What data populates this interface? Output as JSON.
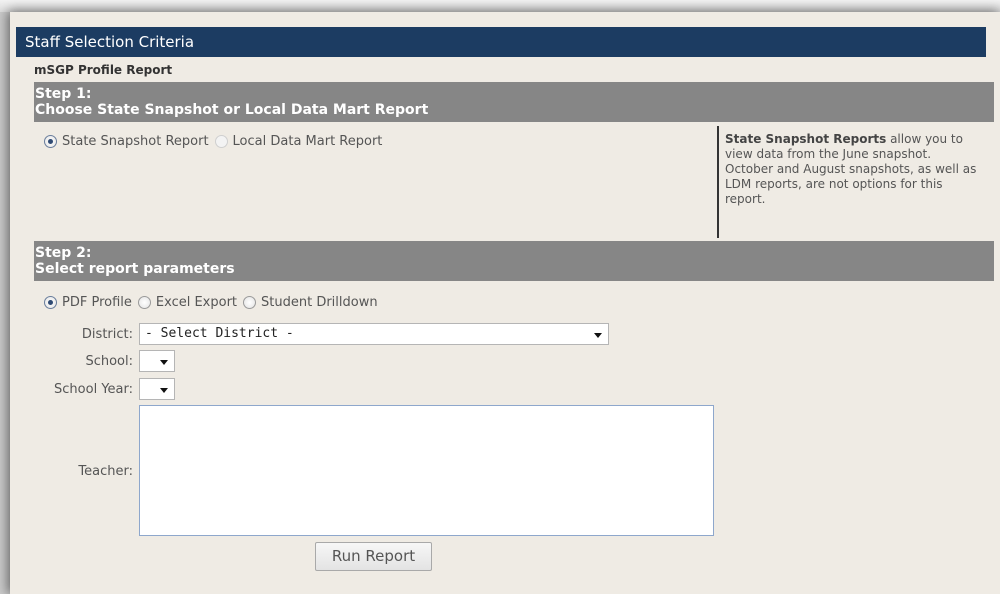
{
  "header": {
    "title": "Staff Selection Criteria",
    "report_name": "mSGP Profile Report"
  },
  "step1": {
    "heading": "Step 1:",
    "title": "Choose State Snapshot or Local Data Mart Report",
    "options": [
      "State Snapshot Report",
      "Local Data Mart Report"
    ],
    "selected": "State Snapshot Report",
    "info_bold": "State Snapshot Reports",
    "info_text": " allow you to view data from the June snapshot. October and August snapshots, as well as LDM reports, are not options for this report."
  },
  "step2": {
    "heading": "Step 2:",
    "title": "Select report parameters",
    "options": [
      "PDF Profile",
      "Excel Export",
      "Student Drilldown"
    ],
    "selected": "PDF Profile"
  },
  "form": {
    "district_label": "District:",
    "district_value": "- Select District -",
    "school_label": "School:",
    "school_value": "",
    "school_year_label": "School Year:",
    "school_year_value": "",
    "teacher_label": "Teacher:"
  },
  "actions": {
    "run_report_label": "Run Report"
  },
  "colors": {
    "title_bar": "#1c3c62",
    "step_bar": "#868686",
    "page_bg": "#efebe4"
  }
}
